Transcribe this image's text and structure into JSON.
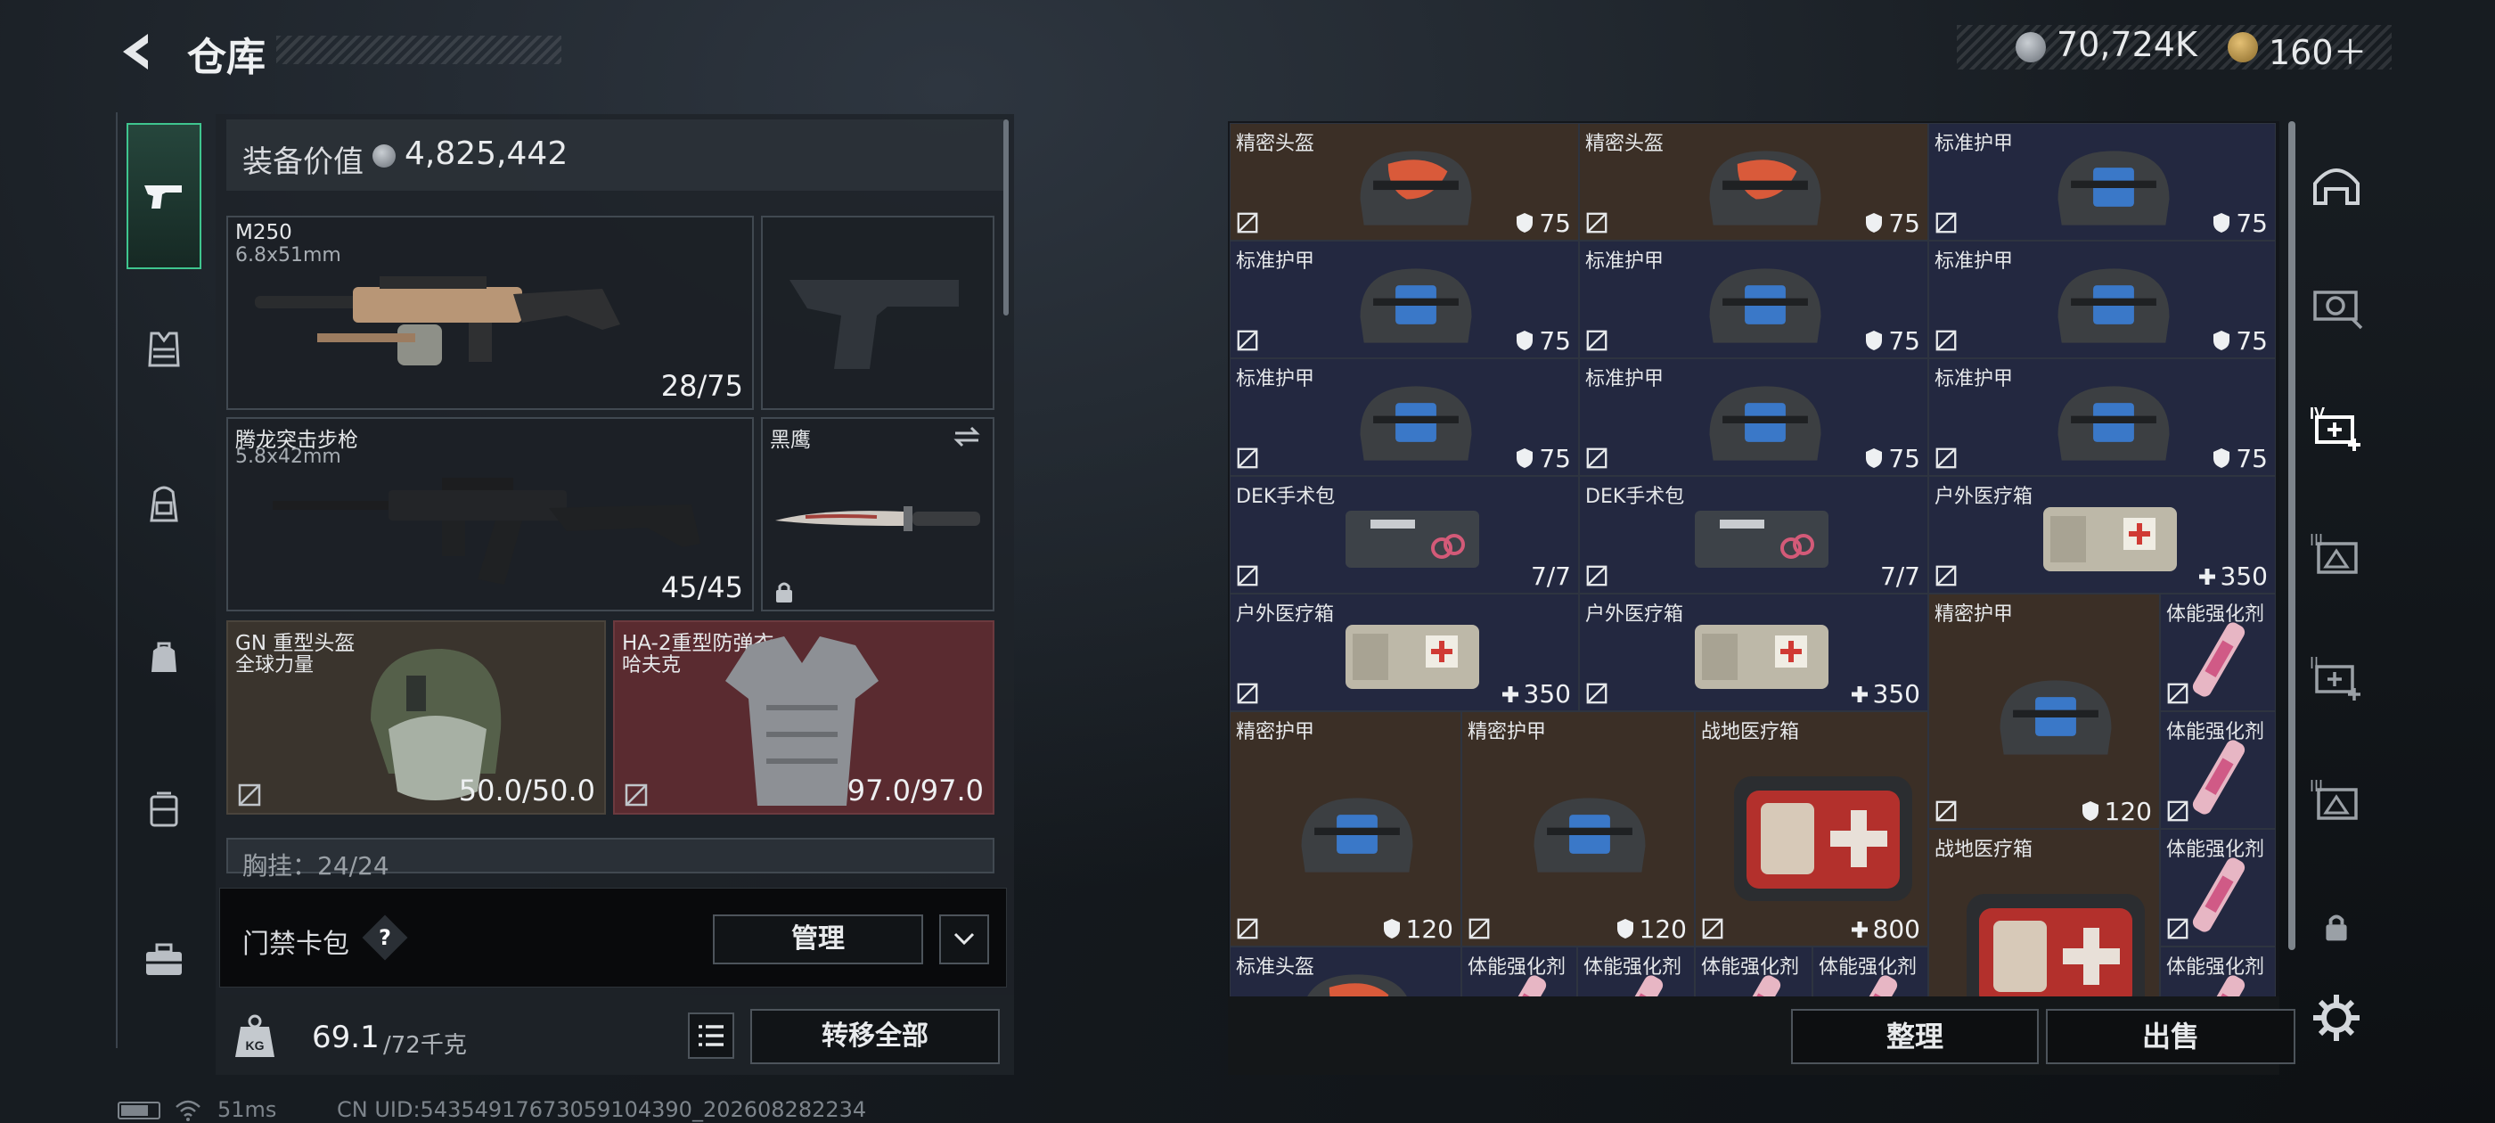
{
  "header": {
    "title": "仓库",
    "currency1": "70,724K",
    "currency2": "160＋"
  },
  "nav": {
    "items": [
      "pistol-icon",
      "vest-rig-icon",
      "backpack-icon",
      "bag-icon",
      "container-icon",
      "toolbox-icon"
    ]
  },
  "loadout": {
    "value_label": "装备价值",
    "value": "4,825,442",
    "primary": {
      "name": "M250",
      "caliber": "6.8x51mm",
      "ammo": "28/75"
    },
    "secondary": {
      "name": "腾龙突击步枪",
      "caliber": "5.8x42mm",
      "ammo": "45/45"
    },
    "melee": {
      "name": "黑鹰"
    },
    "helmet": {
      "name": "GN 重型头盔",
      "sub": "全球力量",
      "durability": "50.0/50.0"
    },
    "armor": {
      "name": "HA-2重型防弹衣",
      "sub": "哈夫克",
      "durability": "97.0/97.0"
    },
    "chest_rig": "胸挂：24/24",
    "keycard": {
      "label": "门禁卡包",
      "help": "?",
      "manage": "管理"
    },
    "weight": {
      "kg_badge": "KG",
      "current": "69.1",
      "max": "/72千克"
    },
    "transfer_all": "转移全部"
  },
  "status": {
    "ping": "51ms",
    "uid": "CN UID:54354917673059104390_202608282234"
  },
  "stash": {
    "cells": [
      {
        "name": "精密头盔",
        "value": "75",
        "type": "helmet",
        "bg": "brown"
      },
      {
        "name": "精密头盔",
        "value": "75",
        "type": "helmet",
        "bg": "brown"
      },
      {
        "name": "标准护甲",
        "value": "75",
        "type": "armor",
        "bg": "navy"
      },
      {
        "name": "标准护甲",
        "value": "75",
        "type": "armor",
        "bg": "navy"
      },
      {
        "name": "标准护甲",
        "value": "75",
        "type": "armor",
        "bg": "navy"
      },
      {
        "name": "标准护甲",
        "value": "75",
        "type": "armor",
        "bg": "navy"
      },
      {
        "name": "标准护甲",
        "value": "75",
        "type": "armor",
        "bg": "navy"
      },
      {
        "name": "标准护甲",
        "value": "75",
        "type": "armor",
        "bg": "navy"
      },
      {
        "name": "标准护甲",
        "value": "75",
        "type": "armor",
        "bg": "navy"
      },
      {
        "name": "DEK手术包",
        "value": "7/7",
        "type": "surgery",
        "bg": "navy"
      },
      {
        "name": "DEK手术包",
        "value": "7/7",
        "type": "surgery",
        "bg": "navy"
      },
      {
        "name": "户外医疗箱",
        "value": "350",
        "type": "medbox",
        "bg": "navy"
      },
      {
        "name": "户外医疗箱",
        "value": "350",
        "type": "medbox",
        "bg": "navy"
      },
      {
        "name": "户外医疗箱",
        "value": "350",
        "type": "medbox",
        "bg": "navy"
      },
      {
        "name": "精密护甲",
        "value": "120",
        "type": "armor",
        "bg": "brown"
      },
      {
        "name": "体能强化剂",
        "value": "",
        "type": "injector",
        "bg": "navy"
      },
      {
        "name": "精密护甲",
        "value": "120",
        "type": "armor",
        "bg": "brown"
      },
      {
        "name": "精密护甲",
        "value": "120",
        "type": "armor",
        "bg": "brown"
      },
      {
        "name": "战地医疗箱",
        "value": "800",
        "type": "firstaid",
        "bg": "brown"
      },
      {
        "name": "体能强化剂",
        "value": "",
        "type": "injector",
        "bg": "navy"
      },
      {
        "name": "战地医疗箱",
        "value": "",
        "type": "firstaid",
        "bg": "brown"
      },
      {
        "name": "体能强化剂",
        "value": "",
        "type": "injector",
        "bg": "navy"
      },
      {
        "name": "标准头盔",
        "value": "",
        "type": "helmet",
        "bg": "navy"
      },
      {
        "name": "体能强化剂",
        "value": "",
        "type": "injector",
        "bg": "navy"
      },
      {
        "name": "体能强化剂",
        "value": "",
        "type": "injector",
        "bg": "navy"
      },
      {
        "name": "体能强化剂",
        "value": "",
        "type": "injector",
        "bg": "navy"
      },
      {
        "name": "体能强化剂",
        "value": "",
        "type": "injector",
        "bg": "navy"
      },
      {
        "name": "体能强化剂",
        "value": "",
        "type": "injector",
        "bg": "navy"
      }
    ],
    "sort": "整理",
    "sell": "出售"
  },
  "right_nav": [
    "dome-icon",
    "scope-icon",
    "tier4-medkit-icon",
    "tier3-armor-icon",
    "tier2-medkit-icon",
    "tier3-helmet-icon",
    "lock-icon",
    "gear-icon"
  ]
}
